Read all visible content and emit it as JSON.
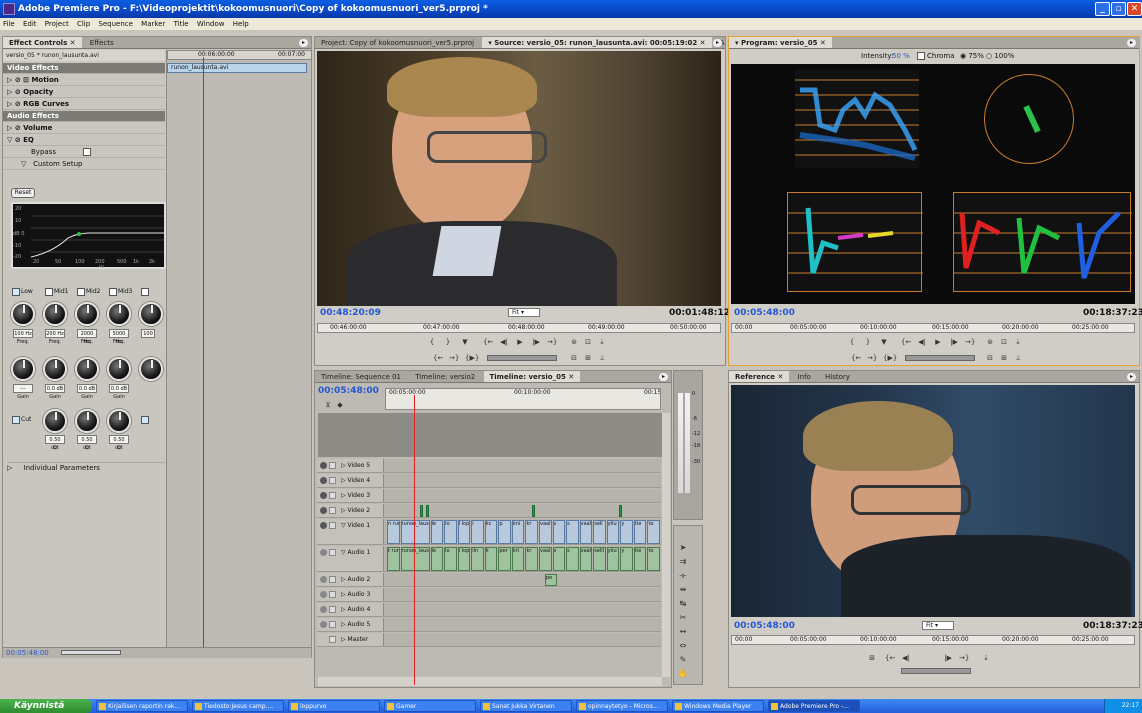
{
  "window": {
    "title": "Adobe Premiere Pro - F:\\Videoprojektit\\kokoomusnuori\\Copy of kokoomusnuori_ver5.prproj *"
  },
  "menu": [
    "File",
    "Edit",
    "Project",
    "Clip",
    "Sequence",
    "Marker",
    "Title",
    "Window",
    "Help"
  ],
  "effect_controls": {
    "tabs": [
      "Effect Controls",
      "Effects"
    ],
    "clip_name": "versio_05 * runon_lausunta.avi",
    "timeline_clip": "runon_lausunta.avi",
    "ruler_start": "00:06:00:00",
    "ruler_end": "00:07:00",
    "sections": {
      "video": "Video Effects",
      "audio": "Audio Effects"
    },
    "effects": {
      "motion": "Motion",
      "opacity": "Opacity",
      "rgb_curves": "RGB Curves",
      "volume": "Volume",
      "eq": "EQ"
    },
    "bypass": "Bypass",
    "custom_setup": "Custom Setup",
    "reset": "Reset",
    "eq_graph_y": [
      "20",
      "10",
      "dB 0",
      "-10",
      "-20"
    ],
    "eq_graph_x": [
      "20",
      "50",
      "100",
      "200",
      "500",
      "1k",
      "2k"
    ],
    "eq_graph_unit": "Hz",
    "bands": [
      "Low",
      "Mid1",
      "Mid2",
      "Mid3"
    ],
    "freq_values": [
      "100 Hz",
      "200 Hz",
      "2000 Hz",
      "5000 Hz",
      "100"
    ],
    "freq_label": "Freq.",
    "gain_values": [
      "---",
      "0.0 dB",
      "0.0 dB",
      "0.0 dB"
    ],
    "gain_label": "Gain",
    "cut_label": "Cut",
    "q_values": [
      "0.50 oct",
      "0.50 oct",
      "0.50 oct"
    ],
    "q_label": "Q",
    "individual_params": "Individual Parameters",
    "bottom_time": "00:05:48:00"
  },
  "source": {
    "tabs": [
      "Project: Copy of kokoomusnuori_ver5.prproj",
      "Source: versio_05: runon_lausunta.avi: 00:05:19:02",
      "Audio Mixer: versio"
    ],
    "time_current": "00:48:20:09",
    "fit": "Fit",
    "time_duration": "00:01:48:12",
    "ruler": [
      "00:46:00:00",
      "00:47:00:00",
      "00:48:00:00",
      "00:49:00:00",
      "00:50:00:00"
    ]
  },
  "program": {
    "tabs": [
      "Program: versio_05"
    ],
    "intensity_label": "Intensity:",
    "intensity_value": "50 %",
    "chroma": "Chroma",
    "zoom_75": "75%",
    "zoom_100": "100%",
    "time_current": "00:05:48:00",
    "time_duration": "00:18:37:23",
    "ruler": [
      "00:00",
      "00:05:00:00",
      "00:10:00:00",
      "00:15:00:00",
      "00:20:00:00",
      "00:25:00:00"
    ]
  },
  "timeline": {
    "tabs": [
      "Timeline: Sequence 01",
      "Timeline: versio2",
      "Timeline: versio_05"
    ],
    "time": "00:05:48:00",
    "ruler": [
      "00:05:00:00",
      "00:10:00:00",
      "00:15:"
    ],
    "tracks": [
      "Video 5",
      "Video 4",
      "Video 3",
      "Video 2",
      "Video 1",
      "Audio 1",
      "Audio 2",
      "Audio 3",
      "Audio 4",
      "Audio 5",
      "Master"
    ],
    "v1_clips": [
      "n rur",
      "runon_lausunta",
      "le",
      "lo",
      "l loppuko",
      "i",
      "kc",
      "p",
      "kni",
      "kr",
      "vaal",
      "v",
      "s",
      "vaalivi",
      "seli",
      "yliu",
      "y",
      "tie",
      "to"
    ],
    "a1_clips": [
      "t rur",
      "runon_lausunta",
      "le",
      "lo",
      "l loppuko",
      "iln",
      "k",
      "per",
      "kri",
      "kr",
      "vaal",
      "v",
      "s",
      "vaalivi",
      "selli",
      "yliu",
      "y",
      "tie",
      "to"
    ],
    "a2_clip": "pe"
  },
  "meter": {
    "scale": [
      "0",
      "-6",
      "-12",
      "-18",
      "-30"
    ]
  },
  "reference": {
    "tabs": [
      "Reference",
      "Info",
      "History"
    ],
    "time_current": "00:05:48:00",
    "fit": "Fit",
    "time_duration": "00:18:37:23",
    "ruler": [
      "00:00",
      "00:05:00:00",
      "00:10:00:00",
      "00:15:00:00",
      "00:20:00:00",
      "00:25:00:00"
    ]
  },
  "taskbar": {
    "start": "Käynnistä",
    "items": [
      "Kirjallisen raportin rak...",
      "Tiedosto:Jesus camp....",
      "loppurvo",
      "Gamer",
      "Sanat Jukka Virtanen",
      "opinnaytetyo - Micros...",
      "Windows Media Player",
      "Adobe Premiere Pro -..."
    ],
    "clock": "22:17"
  }
}
